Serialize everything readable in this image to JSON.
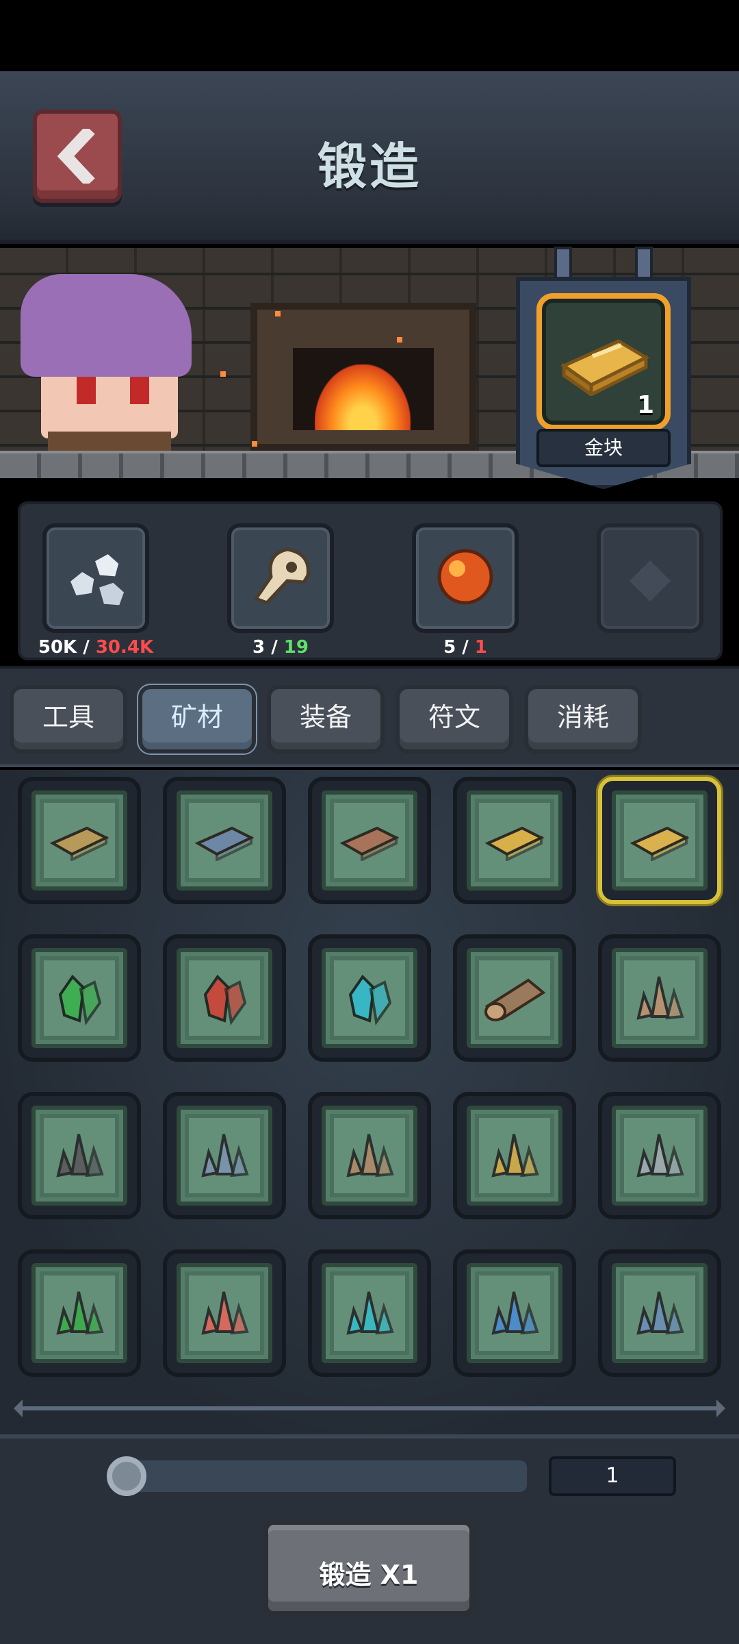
{
  "screen": {
    "title": "锻造",
    "back_icon": "chevron-left-icon"
  },
  "forge_target": {
    "item_name": "金块",
    "count": "1",
    "icon": "gold-bar-icon",
    "highlight_color": "#f0a02a"
  },
  "resources": [
    {
      "icon": "silver-ore-icon",
      "have": "50K",
      "need": "30.4K",
      "need_color": "red"
    },
    {
      "icon": "skull-icon",
      "have": "3",
      "need": "19",
      "need_color": "green"
    },
    {
      "icon": "amber-gem-icon",
      "have": "5",
      "need": "1",
      "need_color": "red"
    },
    {
      "icon": "locked-slot-icon",
      "have": "",
      "need": "",
      "need_color": ""
    }
  ],
  "tabs": [
    {
      "label": "工具",
      "active": false
    },
    {
      "label": "矿材",
      "active": true
    },
    {
      "label": "装备",
      "active": false
    },
    {
      "label": "符文",
      "active": false
    },
    {
      "label": "消耗",
      "active": false
    }
  ],
  "materials": [
    {
      "icon": "bronze-bar-icon",
      "color": "#b79a5a",
      "kind": "bar"
    },
    {
      "icon": "iron-bar-icon",
      "color": "#6d87a6",
      "kind": "bar"
    },
    {
      "icon": "copper-bar-icon",
      "color": "#a7735a",
      "kind": "bar"
    },
    {
      "icon": "gold-bar-small-icon",
      "color": "#d8b04a",
      "kind": "bar"
    },
    {
      "icon": "gold-bar-icon",
      "color": "#d9b14e",
      "kind": "bar",
      "selected": true
    },
    {
      "icon": "green-crystal-icon",
      "color": "#3fae52",
      "kind": "gem"
    },
    {
      "icon": "red-crystal-icon",
      "color": "#c44a3e",
      "kind": "gem"
    },
    {
      "icon": "cyan-crystal-icon",
      "color": "#38b6c4",
      "kind": "gem"
    },
    {
      "icon": "wood-log-icon",
      "color": "#9a7a5c",
      "kind": "log"
    },
    {
      "icon": "tan-shard-icon",
      "color": "#b49270",
      "kind": "shard"
    },
    {
      "icon": "dark-shard-icon",
      "color": "#5a5e5e",
      "kind": "shard"
    },
    {
      "icon": "blue-gray-shard-icon",
      "color": "#7893aa",
      "kind": "shard"
    },
    {
      "icon": "brown-shard-icon",
      "color": "#a88a68",
      "kind": "shard"
    },
    {
      "icon": "yellow-shard-icon",
      "color": "#c9a84a",
      "kind": "shard"
    },
    {
      "icon": "silver-shard-icon",
      "color": "#9aa8ac",
      "kind": "shard"
    },
    {
      "icon": "green-shard-icon",
      "color": "#3eaa4e",
      "kind": "shard"
    },
    {
      "icon": "pink-shard-icon",
      "color": "#d46a5e",
      "kind": "shard"
    },
    {
      "icon": "teal-shard-icon",
      "color": "#3ab8c0",
      "kind": "shard"
    },
    {
      "icon": "blue-shard-icon",
      "color": "#4c8cc8",
      "kind": "shard"
    },
    {
      "icon": "steel-blue-shard-icon",
      "color": "#6a8fb2",
      "kind": "shard"
    }
  ],
  "footer": {
    "quantity": "1",
    "forge_button": "锻造 X1"
  }
}
